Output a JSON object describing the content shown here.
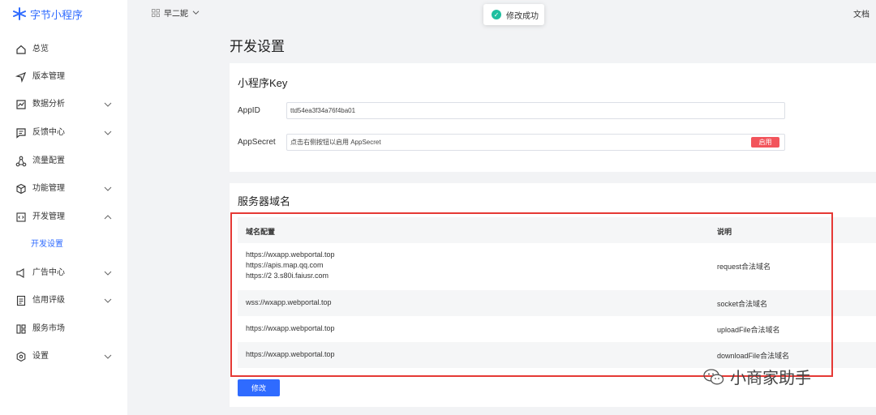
{
  "sidebar": {
    "logo_text": "字节小程序",
    "items": [
      {
        "label": "总览",
        "icon": "home-icon",
        "expandable": false
      },
      {
        "label": "版本管理",
        "icon": "send-icon",
        "expandable": false
      },
      {
        "label": "数据分析",
        "icon": "chart-icon",
        "expandable": true
      },
      {
        "label": "反馈中心",
        "icon": "message-icon",
        "expandable": true
      },
      {
        "label": "流量配置",
        "icon": "share-icon",
        "expandable": false
      },
      {
        "label": "功能管理",
        "icon": "cube-icon",
        "expandable": true
      },
      {
        "label": "开发管理",
        "icon": "code-icon",
        "expandable": true,
        "expanded": true
      },
      {
        "label": "广告中心",
        "icon": "megaphone-icon",
        "expandable": true
      },
      {
        "label": "信用评级",
        "icon": "document-icon",
        "expandable": true
      },
      {
        "label": "服务市场",
        "icon": "store-icon",
        "expandable": false
      },
      {
        "label": "设置",
        "icon": "gear-icon",
        "expandable": true
      }
    ],
    "active_submenu": "开发设置"
  },
  "topbar": {
    "app_name": "早二妮",
    "docs_label": "文档"
  },
  "toast": {
    "message": "修改成功"
  },
  "page": {
    "title": "开发设置"
  },
  "key_card": {
    "title": "小程序Key",
    "appid_label": "AppID",
    "appid_value": "ttd54ea3f34a76f4ba01",
    "secret_label": "AppSecret",
    "secret_placeholder": "点击右侧按钮以启用 AppSecret",
    "enable_label": "启用"
  },
  "domain_card": {
    "title": "服务器域名",
    "columns": [
      "域名配置",
      "说明"
    ],
    "rows": [
      {
        "domains": [
          "https://wxapp.webportal.top",
          "https://apis.map.qq.com",
          "https://2          3.s80i.faiusr.com"
        ],
        "desc": "request合法域名"
      },
      {
        "domains": [
          "wss://wxapp.webportal.top"
        ],
        "desc": "socket合法域名"
      },
      {
        "domains": [
          "https://wxapp.webportal.top"
        ],
        "desc": "uploadFile合法域名"
      },
      {
        "domains": [
          "https://wxapp.webportal.top"
        ],
        "desc": "downloadFile合法域名"
      }
    ],
    "save_label": "修改"
  },
  "watermark": {
    "text": "小商家助手"
  },
  "colors": {
    "accent": "#2f6bff",
    "danger": "#f2545b",
    "highlight": "#e53935",
    "success": "#1fbfa0"
  }
}
